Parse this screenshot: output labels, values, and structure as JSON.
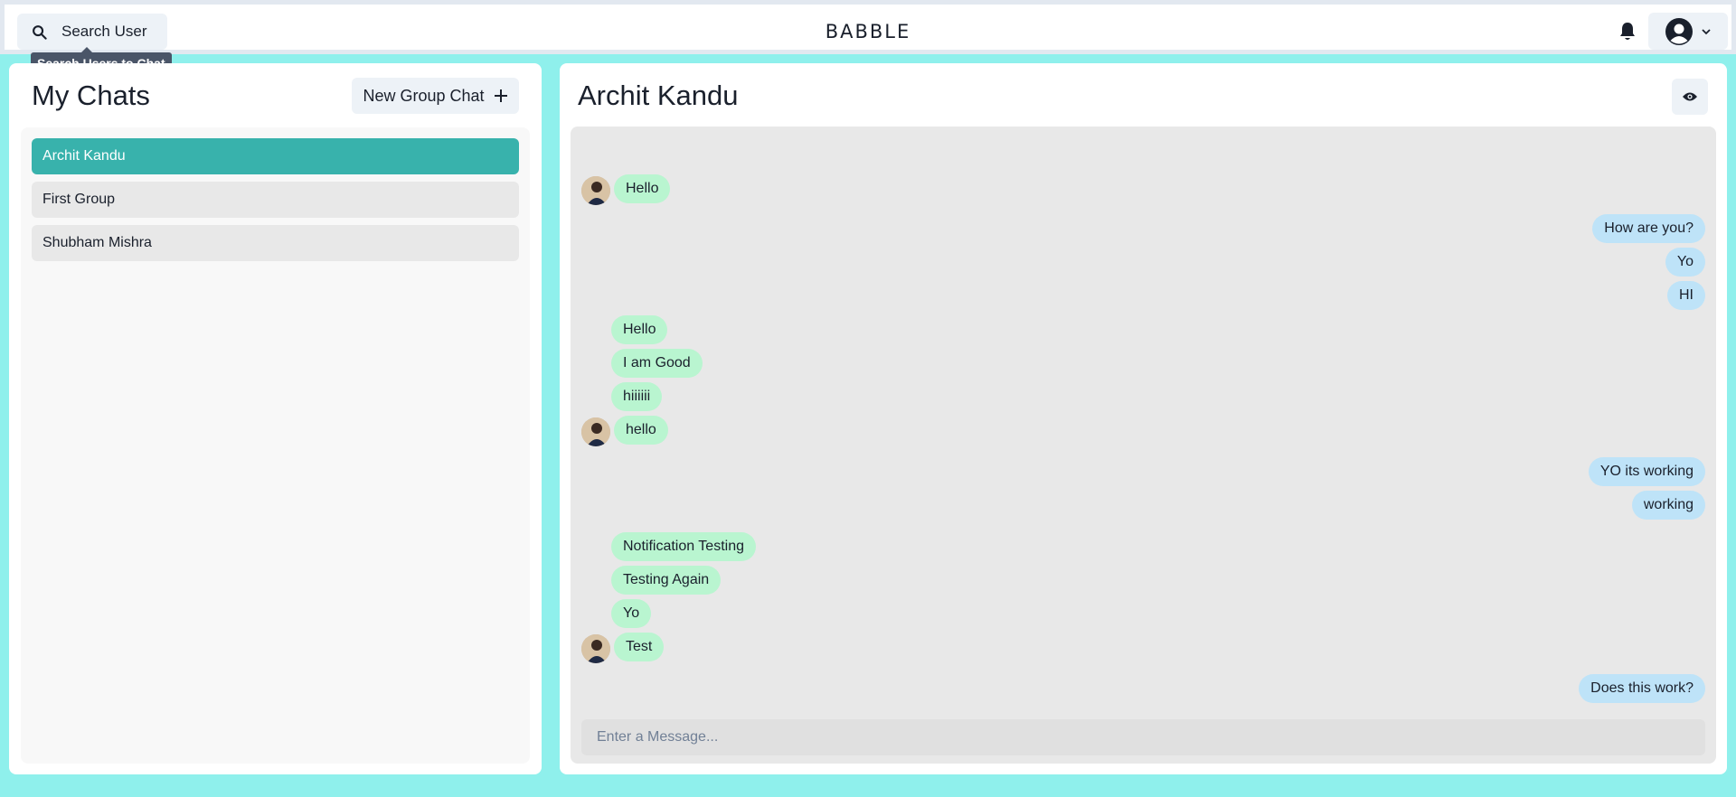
{
  "header": {
    "search_label": "Search User",
    "search_tooltip": "Search Users to Chat",
    "brand": "BABBLE",
    "icons": {
      "search": "search-icon",
      "bell": "bell-icon",
      "avatar": "user-avatar-icon",
      "chevron": "chevron-down-icon"
    }
  },
  "sidebar": {
    "title": "My Chats",
    "new_group_label": "New Group Chat",
    "chats": [
      {
        "name": "Archit Kandu",
        "active": true
      },
      {
        "name": "First Group",
        "active": false
      },
      {
        "name": "Shubham Mishra",
        "active": false
      }
    ]
  },
  "chat": {
    "title": "Archit Kandu",
    "input_placeholder": "Enter a Message...",
    "messages": [
      {
        "text": "Hello",
        "from": "other",
        "avatar": true
      },
      {
        "text": "How are you?",
        "from": "me"
      },
      {
        "text": "Yo",
        "from": "me"
      },
      {
        "text": "HI",
        "from": "me"
      },
      {
        "text": "Hello",
        "from": "other",
        "avatar": false
      },
      {
        "text": "I am Good",
        "from": "other",
        "avatar": false
      },
      {
        "text": "hiiiiii",
        "from": "other",
        "avatar": false
      },
      {
        "text": "hello",
        "from": "other",
        "avatar": true
      },
      {
        "text": "YO its working",
        "from": "me"
      },
      {
        "text": "working",
        "from": "me"
      },
      {
        "text": "Notification Testing",
        "from": "other",
        "avatar": false
      },
      {
        "text": "Testing Again",
        "from": "other",
        "avatar": false
      },
      {
        "text": "Yo",
        "from": "other",
        "avatar": false
      },
      {
        "text": "Test",
        "from": "other",
        "avatar": true
      },
      {
        "text": "Does this work?",
        "from": "me"
      }
    ]
  },
  "colors": {
    "page_bg": "#8ff0ec",
    "active_chat": "#38b2ac",
    "received_bubble": "#b9f5d0",
    "sent_bubble": "#bee3f8"
  }
}
